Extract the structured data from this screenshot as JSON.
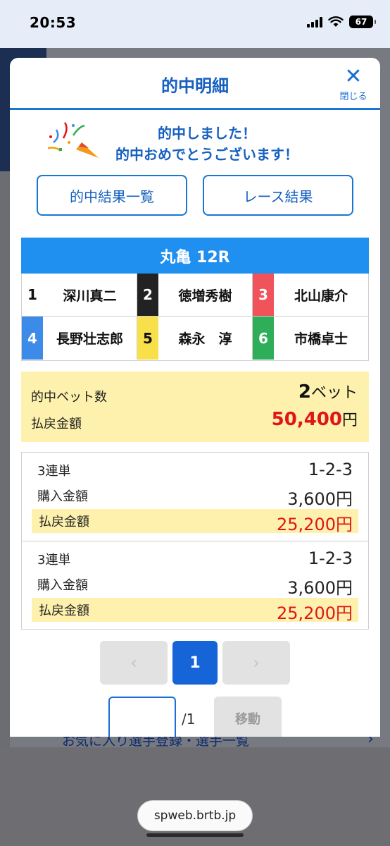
{
  "status_bar": {
    "time": "20:53",
    "battery": "67"
  },
  "modal": {
    "title": "的中明細",
    "close_label": "閉じる",
    "congrats_line1": "的中しました！",
    "congrats_line2": "的中おめでとうございます！",
    "buttons": {
      "hit_results": "的中結果一覧",
      "race_results": "レース結果"
    },
    "race_title": "丸亀 12R",
    "racers": [
      {
        "lane": "1",
        "name": "深川真二",
        "color": "#ffffff",
        "text_color": "#111111"
      },
      {
        "lane": "2",
        "name": "徳増秀樹",
        "color": "#222222",
        "text_color": "#ffffff"
      },
      {
        "lane": "3",
        "name": "北山康介",
        "color": "#f0545a",
        "text_color": "#ffffff"
      },
      {
        "lane": "4",
        "name": "長野壮志郎",
        "color": "#3d8be8",
        "text_color": "#ffffff"
      },
      {
        "lane": "5",
        "name": "森永　淳",
        "color": "#f7e04a",
        "text_color": "#111111"
      },
      {
        "lane": "6",
        "name": "市橋卓士",
        "color": "#2fae5a",
        "text_color": "#ffffff"
      }
    ],
    "summary": {
      "bet_count_label": "的中ベット数",
      "bet_count": "2",
      "bet_unit": "ベット",
      "payout_label": "払戻金額",
      "payout": "50,400",
      "yen": "円"
    },
    "bets": [
      {
        "type": "3連単",
        "combo": "1-2-3",
        "purchase_label": "購入金額",
        "purchase": "3,600円",
        "payout_label": "払戻金額",
        "payout": "25,200円"
      },
      {
        "type": "3連単",
        "combo": "1-2-3",
        "purchase_label": "購入金額",
        "purchase": "3,600円",
        "payout_label": "払戻金額",
        "payout": "25,200円"
      }
    ],
    "pager": {
      "prev": "‹",
      "current": "1",
      "next": "›",
      "total": "/1",
      "move": "移動",
      "page_input_value": ""
    }
  },
  "background": {
    "link_text": "お気に入り選手登録・選手一覧"
  },
  "browser": {
    "url": "spweb.brtb.jp"
  },
  "colors": {
    "accent": "#1976d2",
    "highlight": "#fdf1ad",
    "payout_red": "#e0151a"
  }
}
